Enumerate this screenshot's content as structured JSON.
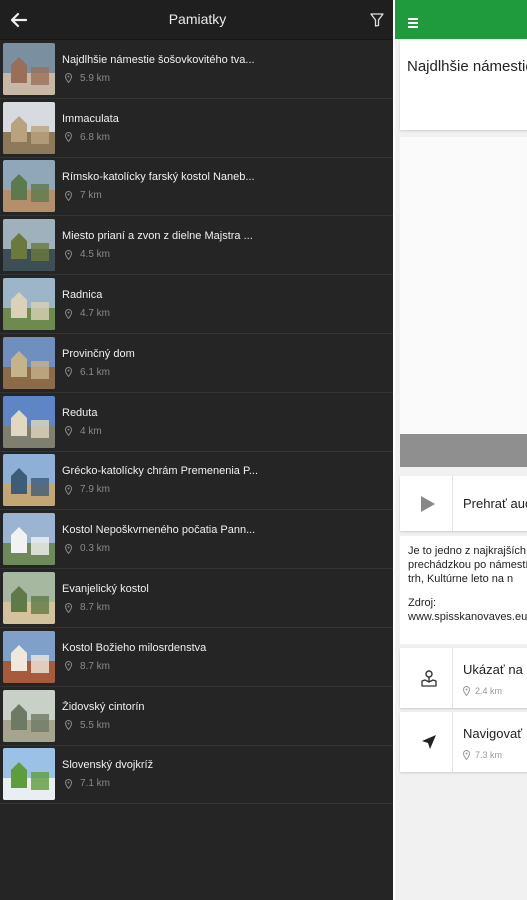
{
  "left_panel": {
    "title": "Pamiatky",
    "items": [
      {
        "title": "Najdlhšie námestie šošovkovitého tva...",
        "distance": "5.9 km"
      },
      {
        "title": "Immaculata",
        "distance": "6.8 km"
      },
      {
        "title": "Rímsko-katolícky farský kostol Naneb...",
        "distance": "7 km"
      },
      {
        "title": "Miesto prianí a zvon z dielne Majstra ...",
        "distance": "4.5 km"
      },
      {
        "title": "Radnica",
        "distance": "4.7 km"
      },
      {
        "title": "Provinčný dom",
        "distance": "6.1 km"
      },
      {
        "title": "Reduta",
        "distance": "4 km"
      },
      {
        "title": "Grécko-katolícky chrám Premenenia P...",
        "distance": "7.9 km"
      },
      {
        "title": "Kostol Nepoškvrneného počatia Pann...",
        "distance": "0.3 km"
      },
      {
        "title": "Evanjelický kostol",
        "distance": "8.7 km"
      },
      {
        "title": "Kostol Božieho milosrdenstva",
        "distance": "8.7 km"
      },
      {
        "title": "Židovský cintorín",
        "distance": "5.5 km"
      },
      {
        "title": "Slovenský dvojkríž",
        "distance": "7.1 km"
      }
    ]
  },
  "right_panel": {
    "title": "Najdlhšie námestie šošovkovitého tvaru",
    "audio_label": "Prehrať audio",
    "description_lines": [
      "Je to jedno z najkrajších",
      "prechádzkou po námestí",
      "trh, Kultúrne leto na n"
    ],
    "source_label": "Zdroj:",
    "source_value": "www.spisskanovaves.eu",
    "show_on_map_label": "Ukázať na mape",
    "show_on_map_distance": "2.4 km",
    "navigate_label": "Navigovať",
    "navigate_distance": "7.3 km"
  },
  "colors": {
    "accent_green": "#1f9a3d",
    "list_background": "#252525"
  }
}
